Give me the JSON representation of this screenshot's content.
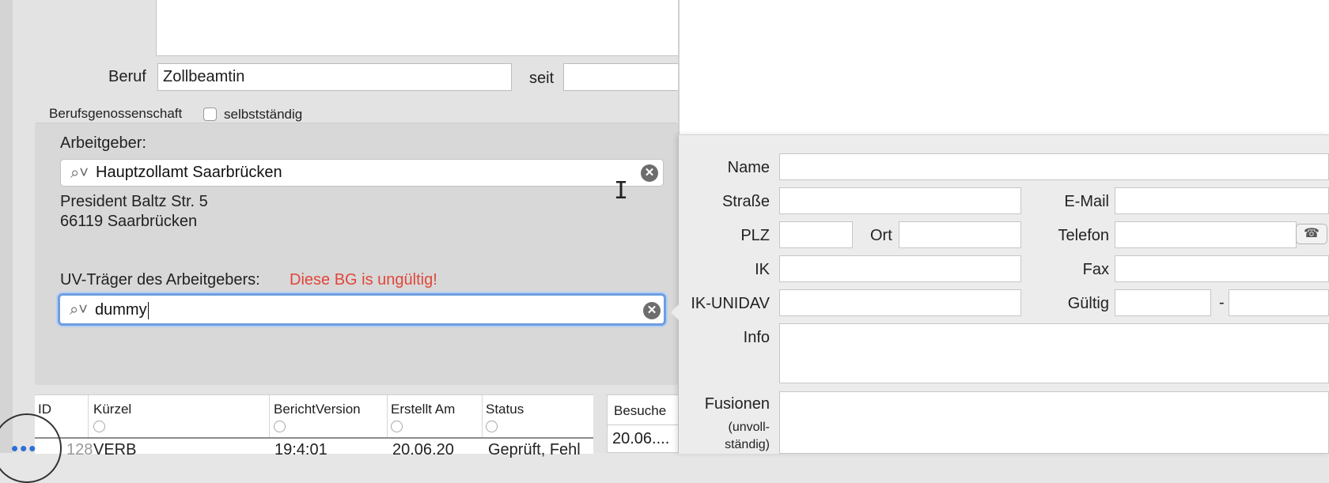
{
  "form": {
    "beruf_label": "Beruf",
    "beruf_value": "Zollbeamtin",
    "seit_label": "seit",
    "seit_value": "",
    "berufsgenossenschaft_label": "Berufsgenossenschaft",
    "selbststaendig_label": "selbstständig",
    "selbststaendig_checked": false
  },
  "arbeitgeber": {
    "label": "Arbeitgeber:",
    "search_value": "Hauptzollamt Saarbrücken",
    "address_line1": "President Baltz Str. 5",
    "address_line2": "66119 Saarbrücken"
  },
  "uv_traeger": {
    "label": "UV-Träger des Arbeitgebers:",
    "error": "Diese BG is ungültig!",
    "search_value": "dummy"
  },
  "icons": {
    "search": "⌕˅",
    "clear": "✕",
    "phone": "☎"
  },
  "table": {
    "columns": [
      "ID",
      "Kürzel",
      "BerichtVersion",
      "Erstellt Am",
      "Status"
    ],
    "row": [
      "128",
      "VERB",
      "19:4:01",
      "20.06.20",
      "Geprüft, Fehl"
    ]
  },
  "besuche": {
    "header": "Besuche",
    "value": "20.06...."
  },
  "detail": {
    "name_label": "Name",
    "strasse_label": "Straße",
    "plz_label": "PLZ",
    "ort_label": "Ort",
    "ik_label": "IK",
    "ik_unidav_label": "IK-UNIDAV",
    "info_label": "Info",
    "fusionen_label": "Fusionen",
    "fusionen_note": "(unvoll-ständig)",
    "fusionen_note_line1": "(unvoll-",
    "fusionen_note_line2": "ständig)",
    "email_label": "E-Mail",
    "telefon_label": "Telefon",
    "fax_label": "Fax",
    "gueltig_label": "Gültig",
    "gueltig_sep": "-"
  },
  "colors": {
    "error": "#e0463c",
    "focus_ring": "#6f9de0",
    "accent_dots": "#2f6fd6"
  }
}
